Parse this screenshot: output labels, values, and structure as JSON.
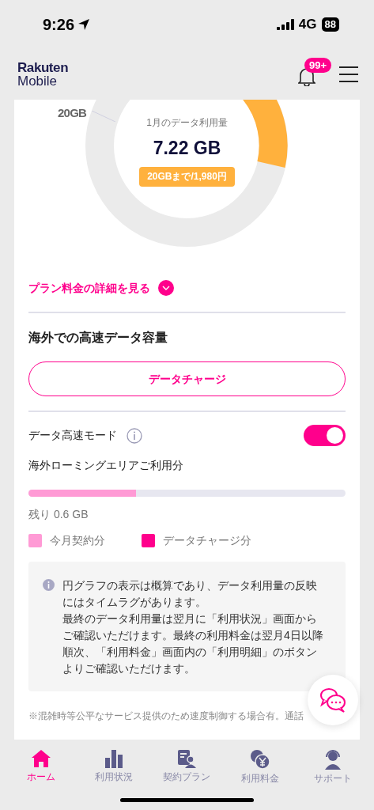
{
  "status_bar": {
    "time": "9:26",
    "network": "4G",
    "battery": "88"
  },
  "header": {
    "logo_top": "Rakuten",
    "logo_bottom": "Mobile",
    "notification_badge": "99+"
  },
  "usage": {
    "max_label": "20GB",
    "caption": "1月のデータ利用量",
    "amount": "7.22 GB",
    "plan_badge": "20GBまで/1,980円"
  },
  "plan_details_link": "プラン料金の詳細を見る",
  "overseas": {
    "title": "海外での高速データ容量",
    "charge_button": "データチャージ",
    "speed_mode": {
      "label": "データ高速モード",
      "on": true
    },
    "roaming_label": "海外ローミングエリアご利用分",
    "level": 0.34,
    "remaining": "残り 0.6 GB",
    "legend": [
      {
        "label": "今月契約分",
        "color": "#ff9ad5"
      },
      {
        "label": "データチャージ分",
        "color": "#ff008c"
      }
    ]
  },
  "notice": [
    "円グラフの表示は概算であり、データ利用量の反映にはタイムラグがあります。",
    "最終のデータ利用量は翌月に「利用状況」画面からご確認いただけます。最終の利用料金は翌月4日以降順次、「利用料金」画面内の「利用明細」のボタンよりご確認いただけます。"
  ],
  "footnote": "※混雑時等公平なサービス提供のため速度制御する場合有。通話",
  "tabs": [
    {
      "label": "ホーム",
      "kind": "home",
      "selected": true
    },
    {
      "label": "利用状況",
      "kind": "usage",
      "selected": false
    },
    {
      "label": "契約プラン",
      "kind": "plan",
      "selected": false
    },
    {
      "label": "利用料金",
      "kind": "fee",
      "selected": false
    },
    {
      "label": "サポート",
      "kind": "support",
      "selected": false
    }
  ]
}
